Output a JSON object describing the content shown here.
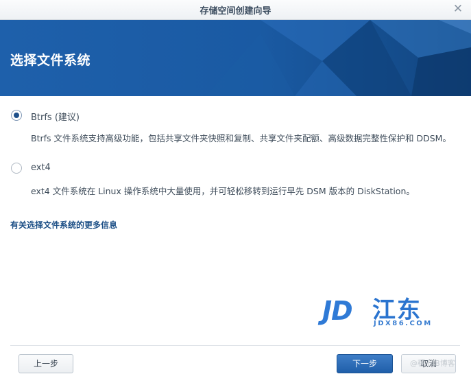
{
  "window": {
    "title": "存储空间创建向导",
    "close_icon": "close-icon"
  },
  "banner": {
    "heading": "选择文件系统",
    "color": "#1a5aa3"
  },
  "options": [
    {
      "label": "Btrfs (建议)",
      "description": "Btrfs 文件系统支持高级功能，包括共享文件夹快照和复制、共享文件夹配额、高级数据完整性保护和 DDSM。",
      "selected": true
    },
    {
      "label": "ext4",
      "description": "ext4 文件系统在 Linux 操作系统中大量使用，并可轻松移转到运行早先 DSM 版本的 DiskStation。",
      "selected": false
    }
  ],
  "more_info_link": "有关选择文件系统的更多信息",
  "watermark": {
    "logo_letters": "JD",
    "logo_chinese": "江东",
    "url": "JDX86.COM"
  },
  "footer": {
    "prev_label": "上一步",
    "next_label": "下一步",
    "cancel_label": "取消",
    "overlay_text": "@稀土JB博客",
    "accent_color": "#1f5ea9"
  }
}
